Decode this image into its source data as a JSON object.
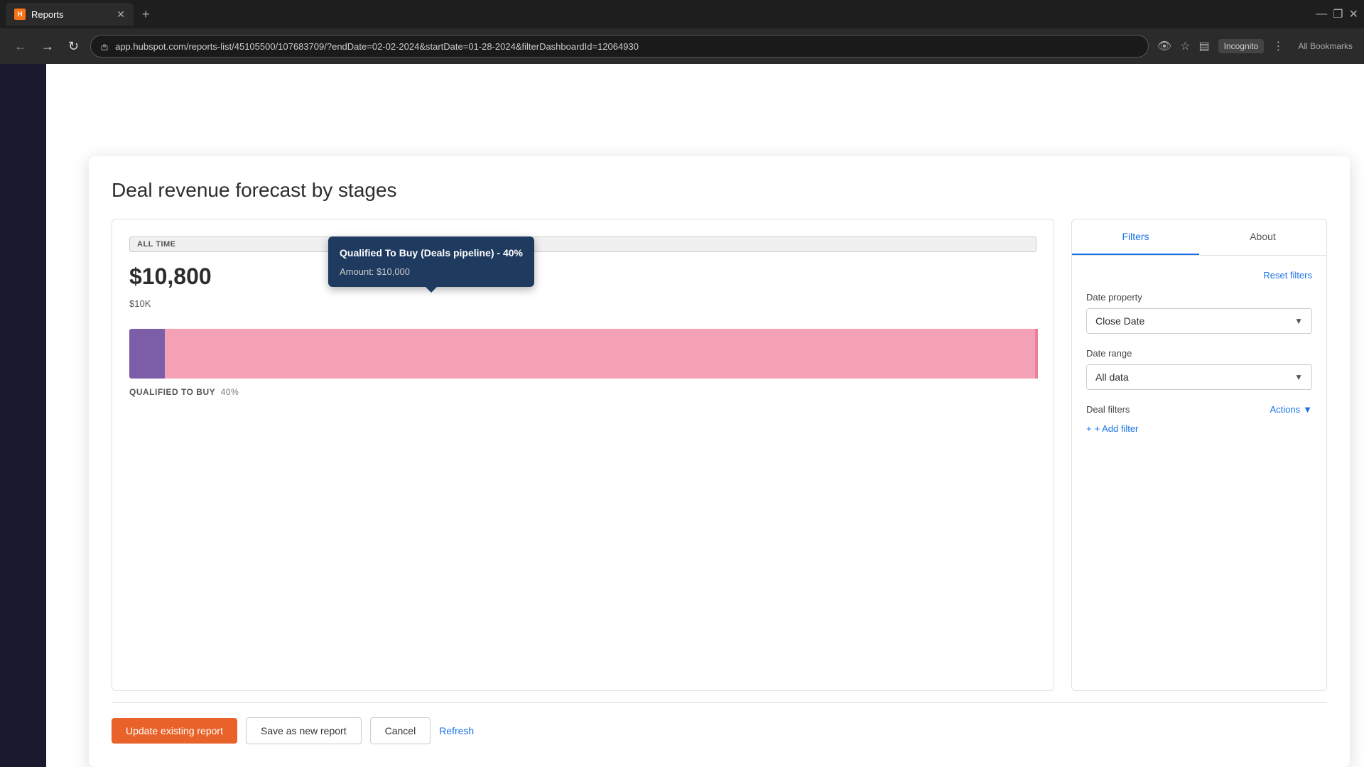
{
  "browser": {
    "tab_title": "Reports",
    "tab_favicon": "H",
    "url": "app.hubspot.com/reports-list/45105500/107683709/?endDate=02-02-2024&startDate=01-28-2024&filterDashboardId=12064930",
    "new_tab_icon": "+",
    "nav_back": "←",
    "nav_forward": "→",
    "nav_refresh": "↻",
    "incognito_label": "Incognito",
    "bookmarks_label": "All Bookmarks",
    "window_minimize": "—",
    "window_restore": "❐",
    "window_close": "✕"
  },
  "report": {
    "title": "Deal revenue forecast by stages",
    "chart": {
      "badge_label": "ALL TIME",
      "total_value": "$10,800",
      "y_axis_label": "$10K",
      "bar_label": "QUALIFIED TO BUY",
      "bar_percentage": "40%",
      "tooltip": {
        "title": "Qualified To Buy (Deals pipeline) - 40%",
        "amount_label": "Amount: $10,000"
      }
    }
  },
  "filters": {
    "tab_filters": "Filters",
    "tab_about": "About",
    "reset_filters_label": "Reset filters",
    "date_property_label": "Date property",
    "date_property_value": "Close Date",
    "date_range_label": "Date range",
    "date_range_value": "All data",
    "deal_filters_label": "Deal filters",
    "actions_label": "Actions",
    "add_filter_label": "+ Add filter"
  },
  "actions": {
    "update_report_label": "Update existing report",
    "save_new_label": "Save as new report",
    "cancel_label": "Cancel",
    "refresh_label": "Refresh"
  }
}
